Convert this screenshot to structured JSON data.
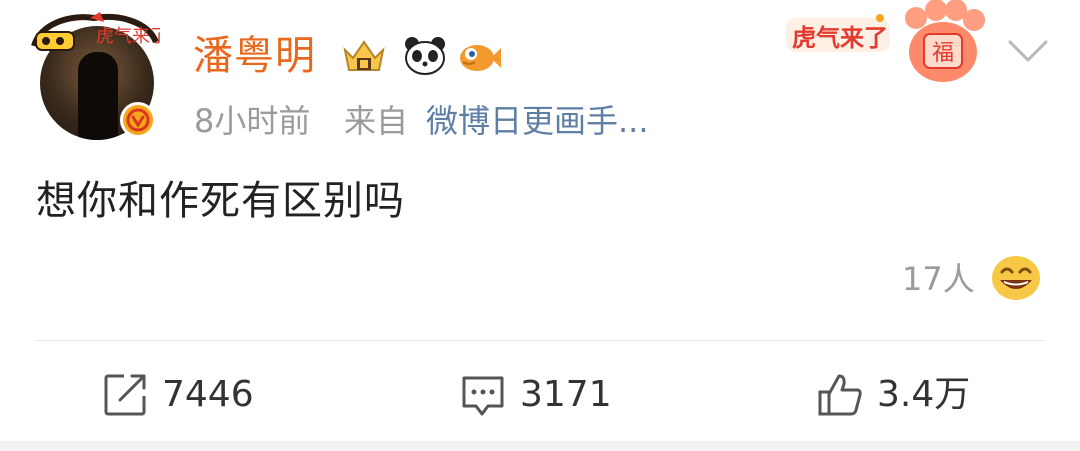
{
  "post": {
    "author": "潘粤明",
    "time": "8小时前",
    "from_label": "来自",
    "source": "微博日更画手...",
    "text": "想你和作死有区别吗",
    "reaction_count": "17人"
  },
  "actions": {
    "repost_count": "7446",
    "comment_count": "3171",
    "like_count": "3.4万"
  },
  "icons": {
    "avatar_frame": "tiger-year-frame-icon",
    "verified": "verified-v-icon",
    "badge_1": "crown-badge-icon",
    "badge_2": "panda-icon",
    "badge_3": "fish-icon",
    "sticker": "tiger-year-sticker-icon",
    "paw": "lucky-paw-icon",
    "menu": "chevron-down-icon",
    "reaction": "grin-emoji-icon",
    "repost": "repost-icon",
    "comment": "comment-icon",
    "like": "thumbs-up-icon"
  },
  "colors": {
    "author": "#e8681e",
    "meta": "#9b9b9b",
    "source": "#5f7ea6",
    "text": "#222222",
    "verified": "#f7a51c"
  }
}
